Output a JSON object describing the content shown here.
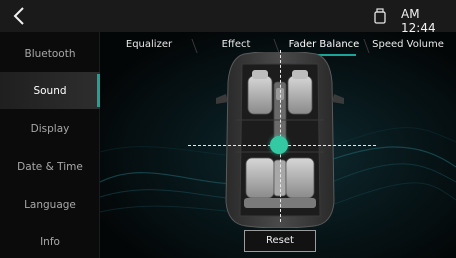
{
  "status_bar": {
    "back_icon": "chevron-left-icon",
    "storage_icon": "usb-drive-icon",
    "clock": "AM 12:44"
  },
  "sidebar": {
    "items": [
      {
        "label": "Bluetooth",
        "active": false
      },
      {
        "label": "Sound",
        "active": true
      },
      {
        "label": "Display",
        "active": false
      },
      {
        "label": "Date & Time",
        "active": false
      },
      {
        "label": "Language",
        "active": false
      },
      {
        "label": "Info",
        "active": false
      }
    ]
  },
  "tabs": [
    {
      "label": "Equalizer",
      "active": false
    },
    {
      "label": "Effect",
      "active": false
    },
    {
      "label": "Fader Balance",
      "active": true
    },
    {
      "label": "Speed Volume",
      "active": false
    }
  ],
  "fader_balance": {
    "reset_label": "Reset"
  },
  "colors": {
    "accent": "#1aa598",
    "balance_dot": "#33c9a3",
    "background": "#000000",
    "topbar": "#1a1a1a"
  }
}
